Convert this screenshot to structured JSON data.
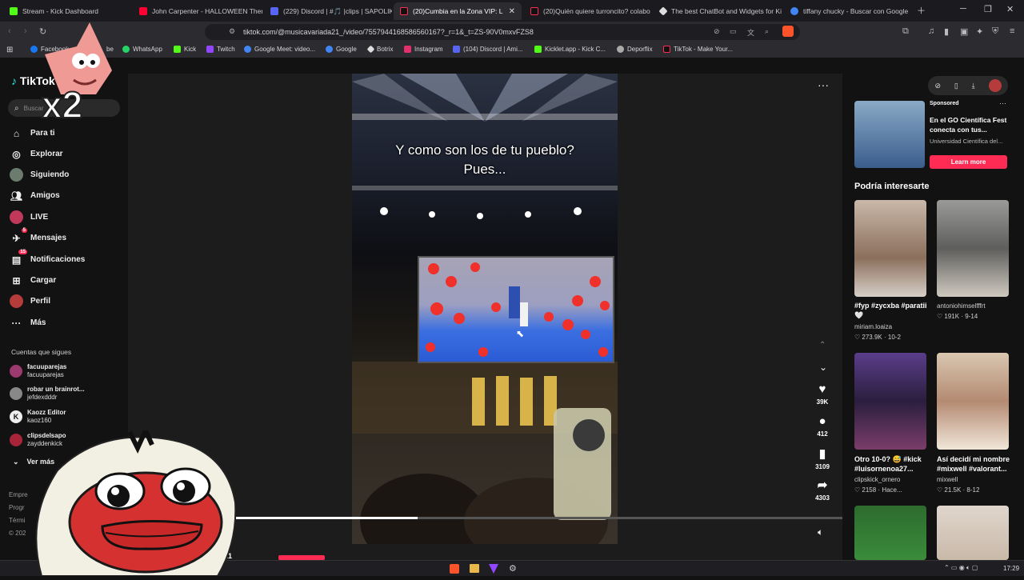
{
  "tabs": [
    {
      "title": "Stream - Kick Dashboard",
      "color": "#53fc18"
    },
    {
      "title": "John Carpenter - HALLOWEEN Them",
      "color": "#ff0033"
    },
    {
      "title": "(229) Discord | #🎵 |clips | SAPOLIK",
      "color": "#5865f2"
    },
    {
      "title": "(20)Cumbia en la Zona VIP: L",
      "color": "#fe2c55"
    },
    {
      "title": "(20)Quién quiere turroncito? colabo",
      "color": "#fe2c55"
    },
    {
      "title": "The best ChatBot and Widgets for Ki",
      "color": "#dddddd"
    },
    {
      "title": "tiffany chucky - Buscar con Google",
      "color": "#4285f4"
    }
  ],
  "address": "tiktok.com/@musicavariada21_/video/7557944168586560167?_r=1&_t=ZS-90V0mxvFZS8",
  "bookmarks": [
    "Facebook",
    "be",
    "WhatsApp",
    "Kick",
    "Twitch",
    "Google Meet: video...",
    "Google",
    "Botrix",
    "Instagram",
    "(104) Discord | Ami...",
    "Kicklet.app - Kick C...",
    "Deporflix",
    "TikTok - Make Your..."
  ],
  "sidebar": {
    "logo": "TikTok",
    "search_placeholder": "Buscar",
    "items": [
      {
        "label": "Para ti",
        "icon": "home-icon"
      },
      {
        "label": "Explorar",
        "icon": "compass-icon"
      },
      {
        "label": "Siguiendo",
        "icon": "following-icon"
      },
      {
        "label": "Amigos",
        "icon": "friends-icon"
      },
      {
        "label": "LIVE",
        "icon": "live-icon"
      },
      {
        "label": "Mensajes",
        "icon": "messages-icon",
        "badge": "5"
      },
      {
        "label": "Notificaciones",
        "icon": "notifications-icon",
        "badge": "15"
      },
      {
        "label": "Cargar",
        "icon": "upload-icon"
      },
      {
        "label": "Perfil",
        "icon": "profile-icon"
      },
      {
        "label": "Más",
        "icon": "more-icon"
      }
    ],
    "following_heading": "Cuentas que sigues",
    "following": [
      {
        "name": "facuuparejas",
        "handle": "facuuparejas"
      },
      {
        "name": "robar un brainrot...",
        "handle": "jefdexdddr"
      },
      {
        "name": "Kaozz Editor",
        "handle": "kaoz160"
      },
      {
        "name": "clipsdelsapo",
        "handle": "zayddenkick"
      }
    ],
    "see_more": "Ver más",
    "footer": [
      "Empre",
      "Progr",
      "Térmi",
      "© 202"
    ]
  },
  "video": {
    "caption_line1": "Y como son los de tu pueblo?",
    "caption_line2": "Pues...",
    "likes": "39K",
    "comments": "412",
    "saves": "3109",
    "shares": "4303",
    "progress": 0.3,
    "author_fragment": "21"
  },
  "right": {
    "sponsored_label": "Sponsored",
    "ad_title": "En el GO Científica Fest conecta con tus...",
    "ad_source": "Universidad Científica del...",
    "ad_button": "Learn more",
    "section_title": "Podría interesarte",
    "cards": [
      {
        "title": "#fyp #zycxba #paratii 🤍",
        "author": "miriam.loaiza",
        "likes": "273.9K",
        "date": "10-2"
      },
      {
        "title": "",
        "author": "antoniohimselfffrt",
        "likes": "191K",
        "date": "9-14"
      },
      {
        "title": "Otro 10-0? 😅 #kick #luisornenoa27...",
        "author": "clipskick_ornero",
        "likes": "2158",
        "date": "Hace..."
      },
      {
        "title": "Así decidí mi nombre #mixwell #valorant...",
        "author": "mixwell",
        "likes": "21.5K",
        "date": "8-12"
      }
    ]
  },
  "overlay": {
    "patrick_text": "x2"
  },
  "taskbar": {
    "time": "17:29"
  }
}
